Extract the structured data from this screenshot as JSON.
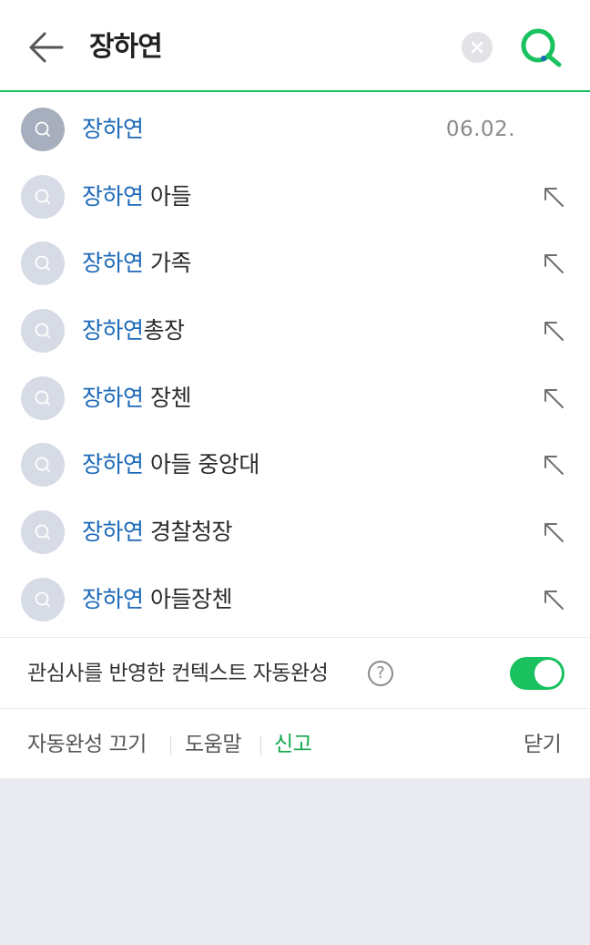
{
  "search": {
    "query": "장하연"
  },
  "suggestions": [
    {
      "highlight": "장하연",
      "rest": "",
      "date": "06.02.",
      "recent": true
    },
    {
      "highlight": "장하연",
      "rest": " 아들"
    },
    {
      "highlight": "장하연",
      "rest": " 가족"
    },
    {
      "highlight": "장하연",
      "rest": "총장"
    },
    {
      "highlight": "장하연",
      "rest": " 장첸"
    },
    {
      "highlight": "장하연",
      "rest": " 아들 중앙대"
    },
    {
      "highlight": "장하연",
      "rest": " 경찰청장"
    },
    {
      "highlight": "장하연",
      "rest": " 아들장첸"
    }
  ],
  "context_autocomplete": {
    "label": "관심사를 반영한 컨텍스트 자동완성",
    "help": "?",
    "enabled": true
  },
  "footer": {
    "turn_off": "자동완성 끄기",
    "help": "도움말",
    "report": "신고",
    "close": "닫기"
  },
  "colors": {
    "accent": "#19c25f",
    "highlight": "#1c69b8",
    "background": "#e9ebf0"
  }
}
